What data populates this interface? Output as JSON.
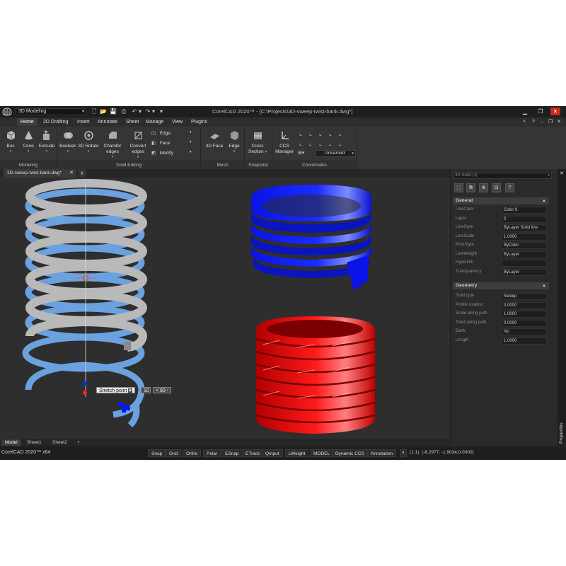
{
  "titlebar": {
    "workspace": "3D Modeling",
    "title": "CorelCAD 2020™ - [C:\\Projects\\3D-sweep-twist-bank.dwg*]"
  },
  "menu": {
    "items": [
      "Home",
      "2D Drafting",
      "Insert",
      "Annotate",
      "Sheet",
      "Manage",
      "View",
      "Plugins"
    ]
  },
  "ribbon": {
    "modeling": {
      "box": "Box",
      "cone": "Cone",
      "extrude": "Extrude",
      "group": "Modeling"
    },
    "solid_editing": {
      "boolean": "Boolean",
      "rotate3d": "3D Rotate",
      "chamfer_line1": "Chamfer",
      "chamfer_line2": "edges",
      "convert_line1": "Convert",
      "convert_line2": "edges",
      "edge": "Edge",
      "face": "Face",
      "modify": "Modify",
      "group": "Solid Editing"
    },
    "mesh": {
      "face3d": "3D Face",
      "edge": "Edge",
      "group": "Mesh"
    },
    "snapshot": {
      "cross_line1": "Cross",
      "cross_line2": "Section",
      "group": "Snapshot"
    },
    "coordinates": {
      "ccs_line1": "CCS",
      "ccs_line2": "Manager",
      "unnamed": "Unnamed",
      "group": "Coordinates"
    }
  },
  "doc": {
    "tab": "3D-sweep-twist-bank.dwg*"
  },
  "overlay": {
    "stretch": "Stretch point",
    "dist": "10",
    "angle": "< 90"
  },
  "properties": {
    "selector": "3D Solid (1)",
    "panel_title": "Properties",
    "general_title": "General",
    "general": [
      {
        "label": "LineColor",
        "value": "Color 9"
      },
      {
        "label": "Layer",
        "value": "0"
      },
      {
        "label": "LineStyle",
        "value": "ByLayer     Solid line"
      },
      {
        "label": "LineScale",
        "value": "1.0000"
      },
      {
        "label": "PrintStyle",
        "value": "ByColor"
      },
      {
        "label": "LineWeight",
        "value": "ByLayer"
      },
      {
        "label": "Hyperlink",
        "value": ""
      },
      {
        "label": "Transparency",
        "value": "ByLayer"
      }
    ],
    "geometry_title": "Geometry",
    "geometry": [
      {
        "label": "Solid type",
        "value": "Sweep"
      },
      {
        "label": "Profile rotation",
        "value": "0.0000"
      },
      {
        "label": "Scale along path",
        "value": "1.0000"
      },
      {
        "label": "Twist along path",
        "value": "0.0000"
      },
      {
        "label": "Bank",
        "value": "No"
      },
      {
        "label": "Length",
        "value": "1.0000"
      }
    ]
  },
  "sheets": [
    "Model",
    "Sheet1",
    "Sheet2"
  ],
  "status": {
    "app": "CorelCAD 2020™ x64",
    "buttons": [
      "Snap",
      "Grid",
      "Ortho",
      "Polar",
      "ESnap",
      "ETrack",
      "QInput",
      "LWeight",
      "MODEL",
      "Dynamic CCS",
      "Annotation"
    ],
    "scale": "(1:1)",
    "coords": "(-8.2977, -1.9034,0.0000)"
  },
  "colors": {
    "blue_solid": "#0a14e6",
    "red_solid": "#e00000",
    "gray_coil": "#b9b9b9",
    "light_blue_coil": "#6fa8e8",
    "close": "#c42b1c"
  }
}
